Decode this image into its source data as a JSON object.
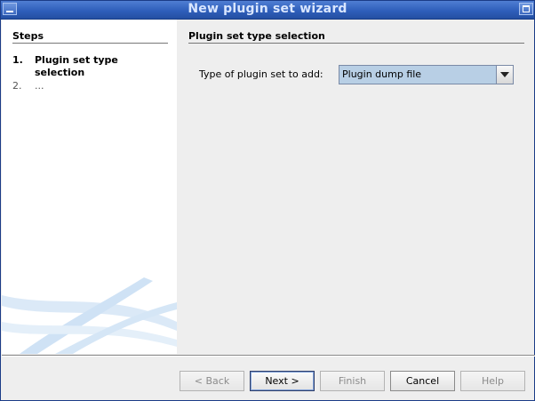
{
  "window": {
    "title": "New plugin set wizard"
  },
  "steps": {
    "title": "Steps",
    "items": [
      {
        "number": "1.",
        "label": "Plugin set type selection"
      },
      {
        "number": "2.",
        "label": "..."
      }
    ]
  },
  "panel": {
    "title": "Plugin set type selection",
    "field_label": "Type of plugin set to add:",
    "selected_value": "Plugin dump file"
  },
  "buttons": {
    "back": "< Back",
    "next": "Next >",
    "finish": "Finish",
    "cancel": "Cancel",
    "help": "Help"
  },
  "colors": {
    "titlebar": "#2f5fbb",
    "combo_selected": "#b8cfe5"
  }
}
